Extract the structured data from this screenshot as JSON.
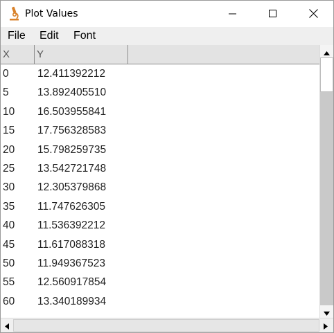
{
  "window": {
    "title": "Plot Values"
  },
  "menu": {
    "file": "File",
    "edit": "Edit",
    "font": "Font"
  },
  "table": {
    "columns": [
      "X",
      "Y"
    ],
    "rows": [
      {
        "x": "0",
        "y": "12.411392212"
      },
      {
        "x": "5",
        "y": "13.892405510"
      },
      {
        "x": "10",
        "y": "16.503955841"
      },
      {
        "x": "15",
        "y": "17.756328583"
      },
      {
        "x": "20",
        "y": "15.798259735"
      },
      {
        "x": "25",
        "y": "13.542721748"
      },
      {
        "x": "30",
        "y": "12.305379868"
      },
      {
        "x": "35",
        "y": "11.747626305"
      },
      {
        "x": "40",
        "y": "11.536392212"
      },
      {
        "x": "45",
        "y": "11.617088318"
      },
      {
        "x": "50",
        "y": "11.949367523"
      },
      {
        "x": "55",
        "y": "12.560917854"
      },
      {
        "x": "60",
        "y": "13.340189934"
      }
    ]
  },
  "icons": {
    "app": "microscope-icon",
    "minimize": "minimize-icon",
    "maximize": "maximize-icon",
    "close": "close-icon"
  },
  "colors": {
    "icon_orange": "#d9822b",
    "header_bg": "#e3e3e3",
    "menubar_bg": "#efefef",
    "scroll_track": "#c9c9c9"
  }
}
